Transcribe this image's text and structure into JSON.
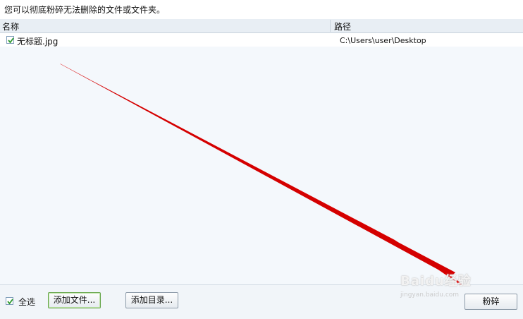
{
  "description": "您可以彻底粉碎无法删除的文件或文件夹。",
  "table": {
    "columns": [
      "名称",
      "路径"
    ],
    "rows": [
      {
        "checked": true,
        "name": "无标题.jpg",
        "path": "C:\\Users\\user\\Desktop"
      }
    ]
  },
  "footer": {
    "select_all_label": "全选",
    "select_all_checked": true,
    "add_file_label": "添加文件...",
    "add_dir_label": "添加目录...",
    "shred_label": "粉碎"
  },
  "watermark": {
    "text": "Baidu经验",
    "sub": "jingyan.baidu.com"
  },
  "colors": {
    "arrow": "#e00000",
    "check": "#2e9a2e"
  }
}
